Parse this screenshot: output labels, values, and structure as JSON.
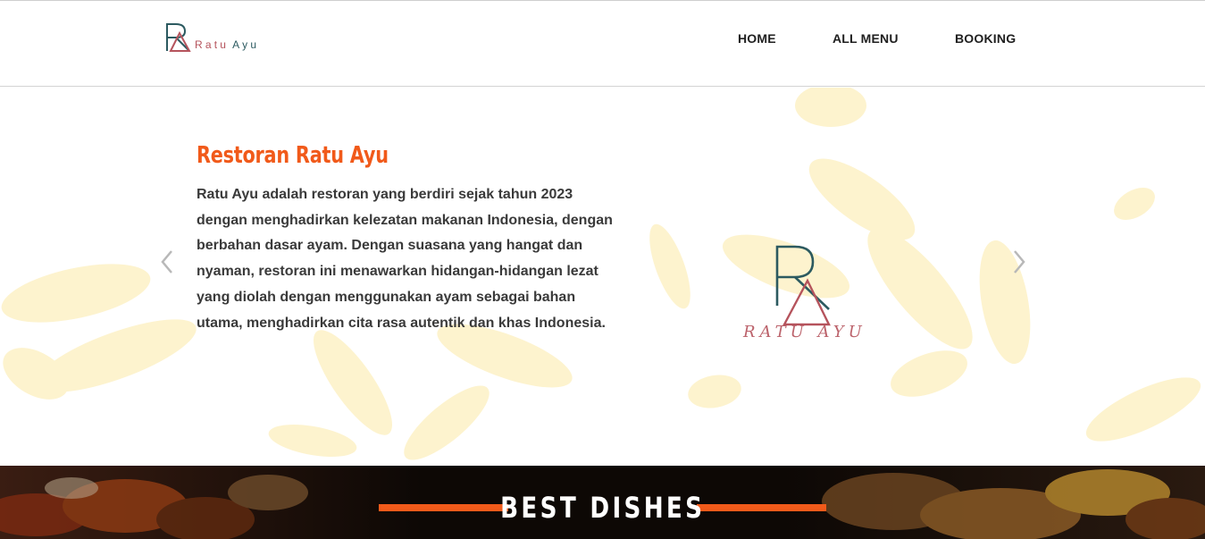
{
  "brand": {
    "logo_word1": "Ratu",
    "logo_word2": "Ayu",
    "logo_icon": "ra-monogram-icon",
    "accent": "#f15a1a",
    "logo_red": "#b5535c",
    "logo_teal": "#2c5a60"
  },
  "nav": {
    "items": [
      {
        "label": "HOME"
      },
      {
        "label": "ALL MENU"
      },
      {
        "label": "BOOKING"
      }
    ]
  },
  "hero": {
    "title": "Restoran Ratu Ayu",
    "description": "Ratu Ayu adalah restoran yang berdiri sejak tahun 2023 dengan menghadirkan kelezatan makanan Indonesia, dengan berbahan dasar ayam. Dengan suasana yang hangat dan nyaman, restoran ini menawarkan hidangan-hidangan lezat yang diolah dengan menggunakan ayam sebagai bahan utama, menghadirkan cita rasa autentik dan khas Indonesia.",
    "logo_caption": "RATU AYU",
    "prev_icon": "chevron-left-icon",
    "next_icon": "chevron-right-icon"
  },
  "dishes": {
    "heading": "BEST DISHES"
  }
}
